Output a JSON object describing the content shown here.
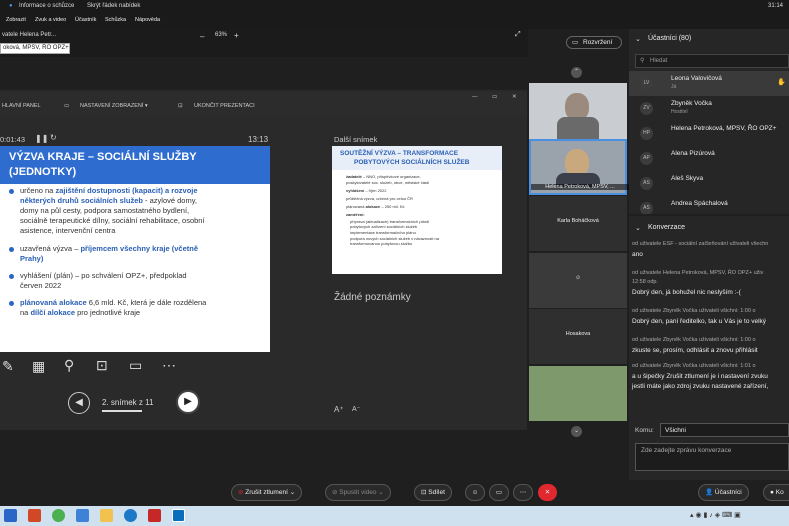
{
  "topbar": {
    "info_label": "Informace o schůzce",
    "hide_label": "Skrýt řádek nabídek",
    "time": "31:14"
  },
  "menubar": {
    "items": [
      "Zobrazit",
      "Zvuk a video",
      "Účastník",
      "Schůzka",
      "Nápověda"
    ]
  },
  "sharebar": {
    "share_title": "vatele Helena Petr...",
    "zoom": "63%",
    "presenter_input": "oková, MPSV, ŘO OPZ+"
  },
  "layout_button": "Rozvržení",
  "ppt_toolbar": {
    "main_panel": "HLAVNÍ PANEL",
    "display_settings": "NASTAVENÍ ZOBRAZENÍ ▾",
    "end_presentation": "UKONČIT PREZENTACI"
  },
  "timer": {
    "elapsed": "0:01:43",
    "clock": "13:13"
  },
  "slide": {
    "title_line1": "VÝZVA KRAJE – SOCIÁLNÍ SLUŽBY",
    "title_line2": "(JEDNOTKY)",
    "b1_l1_pre": "určeno na ",
    "b1_l1_bold": "zajištění dostupnosti (kapacit) a rozvoje",
    "b1_l2_bold": "některých druhů sociálních služeb",
    "b1_l2_post": " - azylové domy,",
    "b1_l3": "domy na půl cesty, podpora samostatného bydlení,",
    "b1_l4": "sociálně terapeutické dílny, sociální rehabilitace, osobní",
    "b1_l5": "asistence, intervenční centra",
    "b2_l1_pre": "uzavřená výzva – ",
    "b2_l1_bold": "příjemcem všechny kraje (včetně",
    "b2_l2_bold": "Prahy)",
    "b3_l1": "vyhlášení (plán) – po schválení OPZ+, předpoklad",
    "b3_l2": "červen 2022",
    "b4_l1_bold": "plánovaná alokace",
    "b4_l1_post": " 6,6 mld. Kč, která je dále rozdělena",
    "b4_l2_pre": "na ",
    "b4_l2_bold": "dílčí alokace",
    "b4_l2_post": " pro jednotlivé kraje"
  },
  "next_slide": {
    "label": "Další snímek",
    "title_l1": "SOUTĚŽNÍ VÝZVA – TRANSFORMACE",
    "title_l2": "POBYTOVÝCH SOCIÁLNÍCH SLUŽEB",
    "l1a": "žadatelé",
    "l1b": " – NNO, příspěvkové organizace,",
    "l2": "poskytovatelé soc. služeb, obce, městské části",
    "l3a": "vyhlášení",
    "l3b": " – říjen 2022",
    "l4": "průběžná výzva, určená pro celou ČR",
    "l5a": "plánovaná ",
    "l5b": "alokace",
    "l5c": " – 250 mil. Kč",
    "l6": "zaměření:",
    "l7": "příprava (aktualizace) transformačních plánů",
    "l8": "pobytových zařízení sociálních služeb",
    "l9": "implementace transformačního plánu",
    "l10": "podpora nových sociálních služeb v návaznosti na",
    "l11": "transformovanou pobytovou službu"
  },
  "notes": "Žádné poznámky",
  "slide_nav": {
    "counter": "2. snímek z 11"
  },
  "videos": {
    "tile2_name": "Helena Petroková, MPSV, ...",
    "tile3_name": "Karla Boháčková",
    "tile5_name": "Hosakova"
  },
  "participants": {
    "header": "Účastníci (80)",
    "search_placeholder": "Hledat",
    "list": [
      {
        "initials": "LV",
        "name": "Leona Valovičová",
        "sub": "Já"
      },
      {
        "initials": "ZV",
        "name": "Zbyněk Vočka",
        "sub": "Hostitel"
      },
      {
        "initials": "HP",
        "name": "Helena Petroková, MPSV, ŘO OPZ+",
        "sub": ""
      },
      {
        "initials": "AP",
        "name": "Alena Pizúrová",
        "sub": ""
      },
      {
        "initials": "AS",
        "name": "Aleš Skyva",
        "sub": ""
      },
      {
        "initials": "AS",
        "name": "Andrea Spáchalová",
        "sub": ""
      }
    ]
  },
  "chat": {
    "header": "Konverzace",
    "messages": [
      {
        "h": "od uživatele ESF - sociální začleňování uživateli všechn",
        "b": [
          "ano"
        ]
      },
      {
        "h": "od uživatele Helena Petroková, MPSV, ŘO OPZ+ uživ",
        "h2": "12:58 odp.",
        "b": [
          "Dobrý den, já bohužel nic neslyším :-("
        ]
      },
      {
        "h": "od uživatele Zbyněk Vočka uživateli všichni:    1:00 o",
        "b": [
          "Dobrý den, paní ředitelko, tak u Vás je to velký"
        ]
      },
      {
        "h": "od uživatele Zbyněk Vočka uživateli všichni:    1:00 o",
        "b": [
          "zkuste se, prosím, odhlásit a znovu přihlásit"
        ]
      },
      {
        "h": "od uživatele Zbyněk Vočka uživateli všichni:    1:01 o",
        "b": [
          "a u šipečky Zrušit ztlumení je i nastavení zvuku",
          "jestli máte jako zdroj zvuku nastavené zařízení,"
        ]
      }
    ],
    "to_label": "Komu:",
    "to_value": "Všichni",
    "input_placeholder": "Zde zadejte zprávu konverzace"
  },
  "controls": {
    "unmute": "Zrušit ztlumení",
    "start_video": "Spustit video",
    "share": "Sdílet",
    "participants": "Účastníci",
    "chat": "Ko"
  },
  "colors": {
    "accent": "#2f6ccf",
    "leave": "#e0282e",
    "active": "#4a90e2"
  }
}
